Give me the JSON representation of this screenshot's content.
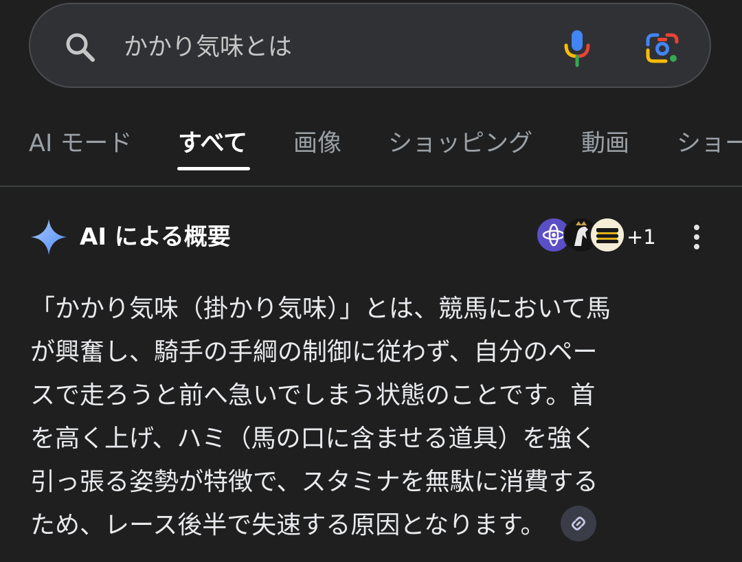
{
  "search": {
    "query": "かかり気味とは",
    "icons": {
      "search": "search-icon",
      "voice": "microphone-icon",
      "lens": "camera-lens-icon"
    }
  },
  "tabs": [
    {
      "label": "AI モード",
      "active": false
    },
    {
      "label": "すべて",
      "active": true
    },
    {
      "label": "画像",
      "active": false
    },
    {
      "label": "ショッピング",
      "active": false
    },
    {
      "label": "動画",
      "active": false
    },
    {
      "label": "ショー",
      "active": false
    }
  ],
  "ai_overview": {
    "title": "AI による概要",
    "source_count": "+1",
    "source_icons": [
      "atom-logo-icon",
      "horse-logo-icon",
      "bee-logo-icon"
    ],
    "body_lines": [
      "「かかり気味（掛かり気味）」とは、競馬において馬",
      "が興奮し、騎手の手綱の制御に従わず、自分のペー",
      "スで走ろうと前へ急いでしまう状態のことです。首",
      "を高く上げ、ハミ（馬の口に含ませる道具）を強く",
      "引っ張る姿勢が特徴で、スタミナを無駄に消費する",
      "ため、レース後半で失速する原因となります。"
    ]
  },
  "colors": {
    "background": "#1f1f1f",
    "search_bar": "#303134",
    "active_tab": "#ffffff",
    "inactive_tab": "#9aa0a6",
    "sparkle": "#8ab4f8"
  }
}
